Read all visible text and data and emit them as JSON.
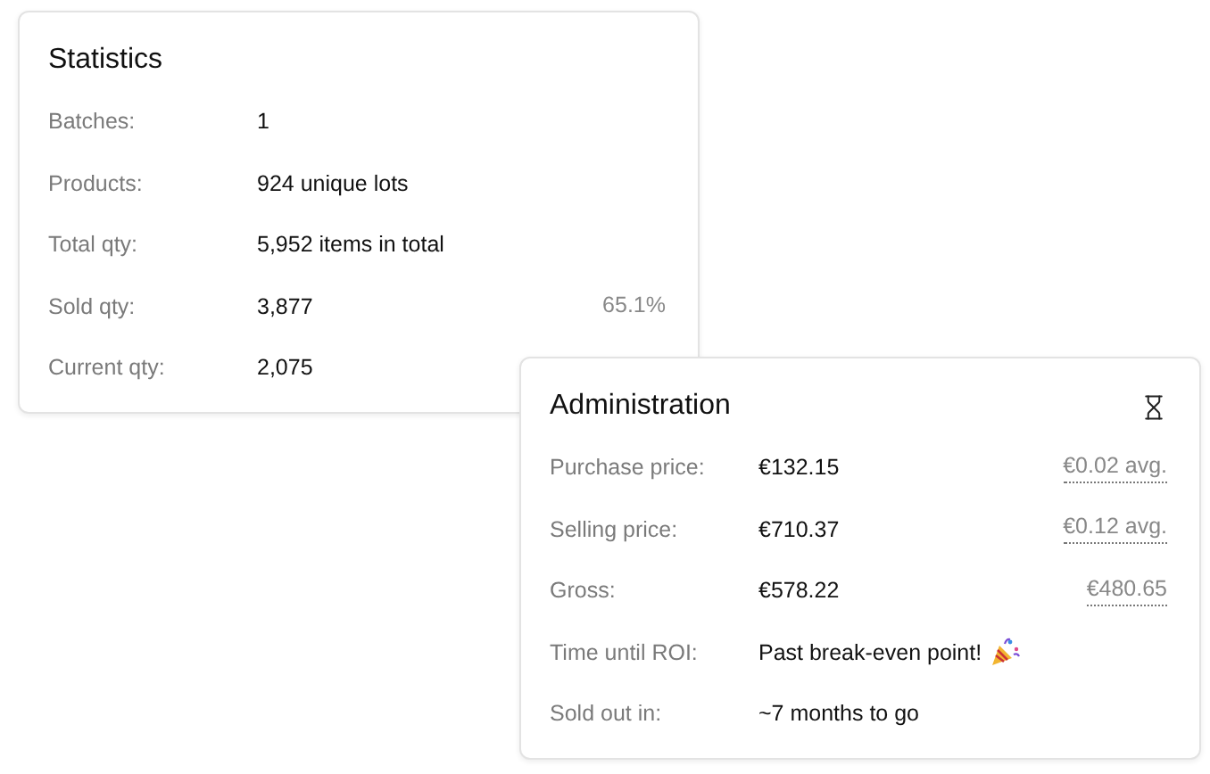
{
  "statistics": {
    "title": "Statistics",
    "rows": [
      {
        "label": "Batches:",
        "value": "1"
      },
      {
        "label": "Products:",
        "value": "924 unique lots"
      },
      {
        "label": "Total qty:",
        "value": "5,952 items in total"
      },
      {
        "label": "Sold qty:",
        "value": "3,877",
        "extra": "65.1%",
        "underlined": false
      },
      {
        "label": "Current qty:",
        "value": "2,075"
      }
    ]
  },
  "administration": {
    "title": "Administration",
    "rows": [
      {
        "label": "Purchase price:",
        "value": "€132.15",
        "extra": "€0.02 avg.",
        "underlined": true
      },
      {
        "label": "Selling price:",
        "value": "€710.37",
        "extra": "€0.12 avg.",
        "underlined": true
      },
      {
        "label": "Gross:",
        "value": "€578.22",
        "extra": "€480.65",
        "underlined": true
      },
      {
        "label": "Time until ROI:",
        "value": "Past break-even point!",
        "kind": "celebrate"
      },
      {
        "label": "Sold out in:",
        "value": "~7 months to go"
      }
    ]
  }
}
